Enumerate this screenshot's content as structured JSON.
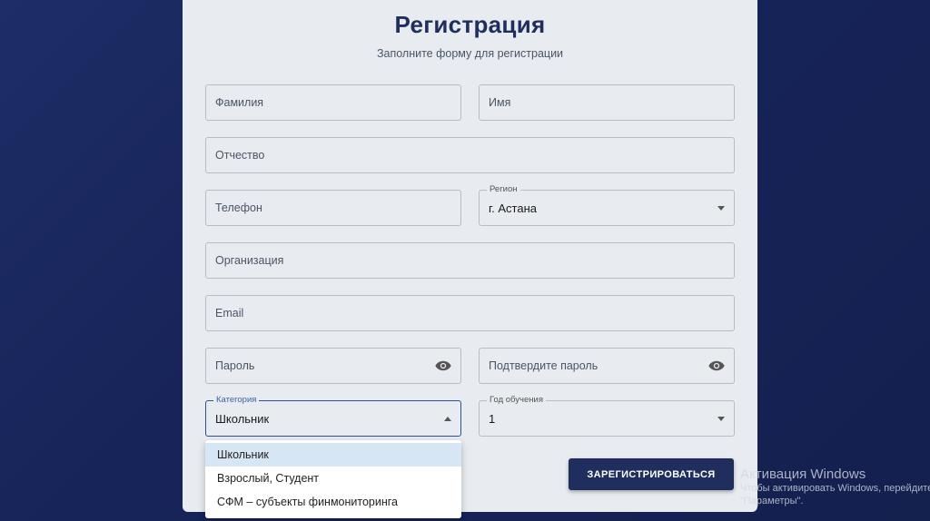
{
  "form": {
    "title": "Регистрация",
    "subtitle": "Заполните форму для регистрации",
    "fields": {
      "last_name": "Фамилия",
      "first_name": "Имя",
      "patronymic": "Отчество",
      "phone": "Телефон",
      "region_label": "Регион",
      "region_value": "г. Астана",
      "organization": "Организация",
      "email": "Email",
      "password": "Пароль",
      "confirm_password": "Подтвердите пароль",
      "category_label": "Категория",
      "category_value": "Школьник",
      "study_year_label": "Год обучения",
      "study_year_value": "1"
    },
    "category_options": [
      "Школьник",
      "Взрослый, Студент",
      "СФМ – субъекты финмониторинга"
    ],
    "submit_label": "ЗАРЕГИСТРИРОВАТЬСЯ"
  },
  "watermark": {
    "title": "Активация Windows",
    "line1": "Чтобы активировать Windows, перейдите",
    "line2": "\"Параметры\"."
  },
  "colors": {
    "background": "#18265a",
    "card": "#e8ebf0",
    "accent": "#1f2e5c",
    "focus": "#2f4f8f",
    "selected_option": "#d7e6f5"
  }
}
